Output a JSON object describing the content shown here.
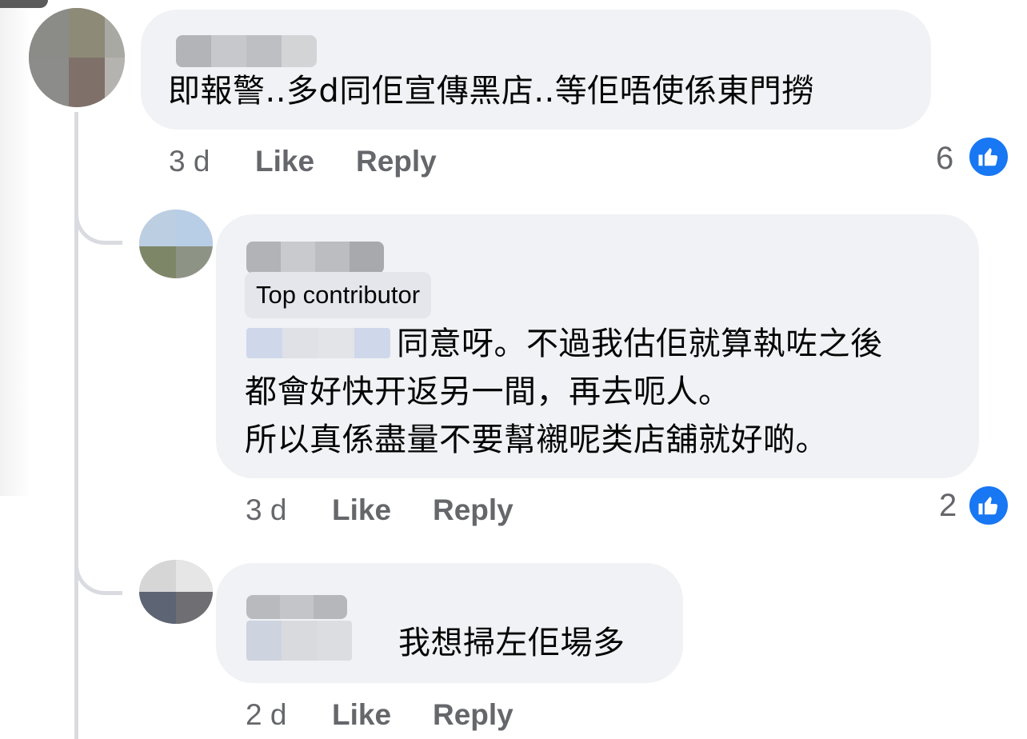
{
  "comments": [
    {
      "id": "c1",
      "author_redacted": true,
      "text": "即報警..多d同佢宣傳黑店..等佢唔使係東門撈",
      "time": "3 d",
      "like_label": "Like",
      "reply_label": "Reply",
      "reaction_count": "6"
    },
    {
      "id": "c2",
      "author_redacted": true,
      "badge": "Top contributor",
      "text_lines": [
        "同意呀。不過我估佢就算執咗之後",
        "都會好快开返另一間，再去呃人。",
        "所以真係盡量不要幫襯呢类店舖就好啲。"
      ],
      "time": "3 d",
      "like_label": "Like",
      "reply_label": "Reply",
      "reaction_count": "2"
    },
    {
      "id": "c3",
      "author_redacted": true,
      "text": "我想掃左佢場多",
      "time": "2 d",
      "like_label": "Like",
      "reply_label": "Reply"
    }
  ],
  "icons": {
    "reaction": "like-thumb-icon"
  },
  "colors": {
    "bubble": "#f0f2f5",
    "meta_text": "#65676b",
    "like_blue": "#1877f2",
    "thread_line": "#d9dbe0"
  }
}
